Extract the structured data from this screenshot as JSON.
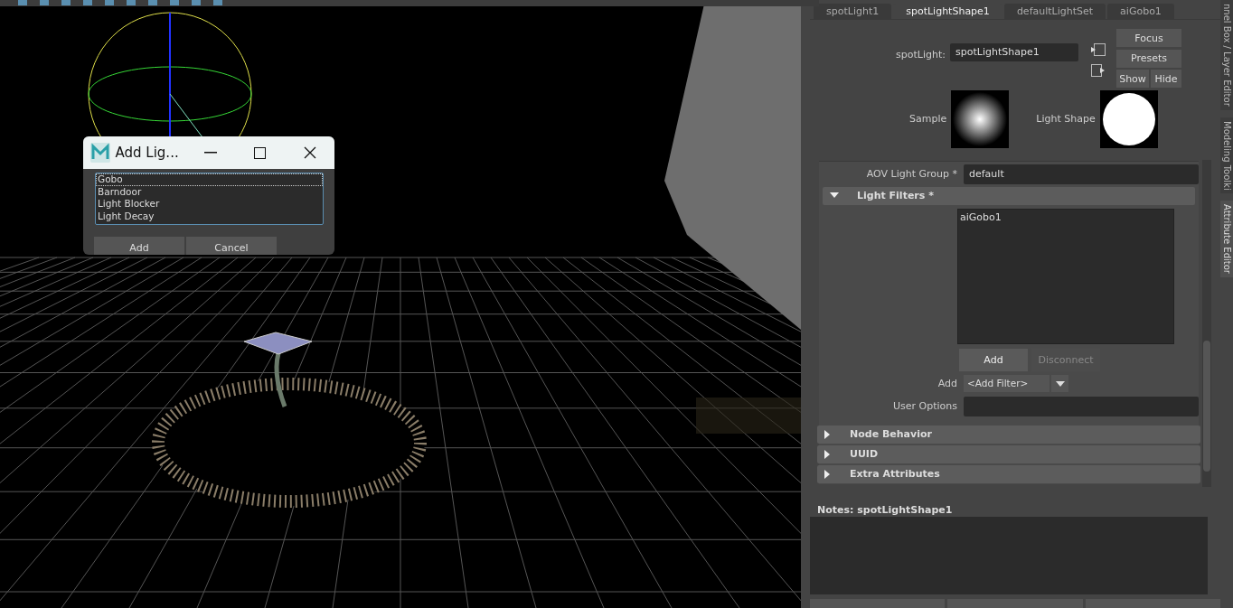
{
  "dialog": {
    "title": "Add Lig...",
    "items": [
      {
        "label": "Gobo",
        "focused": true
      },
      {
        "label": "Barndoor",
        "focused": false
      },
      {
        "label": "Light Blocker",
        "focused": false
      },
      {
        "label": "Light Decay",
        "focused": false
      }
    ],
    "buttons": [
      "Add",
      "Cancel"
    ]
  },
  "attribute_editor": {
    "tabs": [
      {
        "label": "spotLight1",
        "selected": false
      },
      {
        "label": "spotLightShape1",
        "selected": true
      },
      {
        "label": "defaultLightSet",
        "selected": false
      },
      {
        "label": "aiGobo1",
        "selected": false
      }
    ],
    "node_label": "spotLight:",
    "node_name": "spotLightShape1",
    "header_buttons": [
      "Focus",
      "Presets",
      "Show",
      "Hide"
    ],
    "swatches": [
      {
        "label": "Sample",
        "kind": "glow"
      },
      {
        "label": "Light Shape",
        "kind": "disc"
      }
    ],
    "aov_label": "AOV Light Group *",
    "aov_value": "default",
    "light_filters": {
      "title": "Light Filters *",
      "expanded": true,
      "items": [
        "aiGobo1"
      ],
      "buttons": [
        {
          "label": "Add",
          "disabled": false
        },
        {
          "label": "Disconnect",
          "disabled": true
        }
      ],
      "add_label": "Add",
      "add_dropdown": "<Add Filter>",
      "user_options_label": "User Options"
    },
    "sections": [
      {
        "title": "Node Behavior",
        "expanded": false
      },
      {
        "title": "UUID",
        "expanded": false
      },
      {
        "title": "Extra Attributes",
        "expanded": false
      }
    ],
    "notes_label": "Notes:  spotLightShape1"
  },
  "side_tabs": [
    {
      "label": "nnel Box / Layer Editor",
      "selected": false
    },
    {
      "label": "Modeling Toolki",
      "selected": false
    },
    {
      "label": "Attribute Editor",
      "selected": true
    }
  ]
}
